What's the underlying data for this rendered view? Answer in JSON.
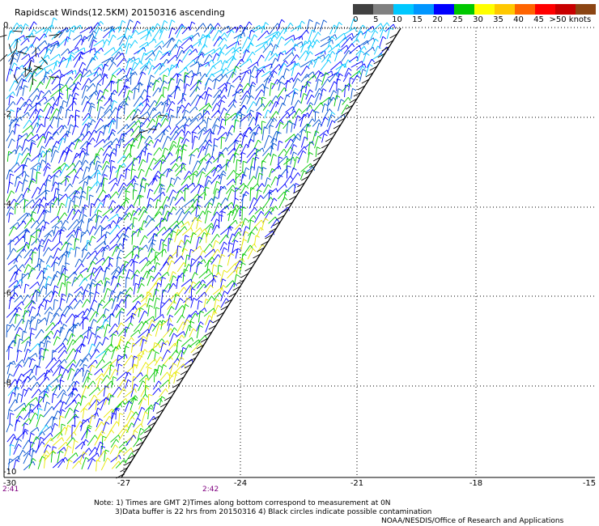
{
  "title": "Rapidscat Winds(12.5KM) 20150316 ascending",
  "legend": {
    "colors": [
      "#404040",
      "#808080",
      "#00c8ff",
      "#0096ff",
      "#0000ff",
      "#00c800",
      "#ffff00",
      "#ffc800",
      "#ff6400",
      "#ff0000",
      "#c80000",
      "#8b4513",
      "#c8a078",
      "#ff00ff",
      "#b400ff",
      "#64008c"
    ],
    "labels": [
      "0",
      "5",
      "10",
      "15",
      "20",
      "25",
      "30",
      "35",
      "40",
      "45",
      ">50 knots"
    ]
  },
  "axes": {
    "x_ticks": [
      "-27",
      "-24",
      "-21",
      "-18",
      "-15"
    ],
    "x_first": "-30",
    "y_ticks": [
      "0",
      "-2",
      "-4",
      "-6",
      "-8",
      "-10"
    ]
  },
  "times": {
    "left": "2:41",
    "mid": "2:42"
  },
  "notes": {
    "line1": "Note: 1) Times are GMT 2)Times along bottom correspond to measurement at 0N",
    "line2": "3)Data buffer is 22 hrs from 20150316 4) Black circles indicate possible contamination",
    "line3": "NOAA/NESDIS/Office of Research and Applications"
  },
  "wind_colors": {
    "light_blue": "#00c8ff",
    "blue": "#0000ff",
    "dark_blue": "#0050d0",
    "green": "#00c800",
    "yellow": "#e8e800",
    "black": "#000000"
  }
}
